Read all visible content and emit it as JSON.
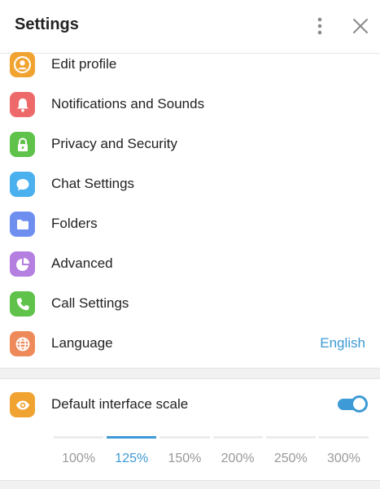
{
  "header": {
    "title": "Settings",
    "more_icon": "more-vertical-icon",
    "close_icon": "close-icon"
  },
  "menu": [
    {
      "label": "Edit profile",
      "icon": "user-icon",
      "color": "#f0a330"
    },
    {
      "label": "Notifications and Sounds",
      "icon": "bell-icon",
      "color": "#ee6a6a"
    },
    {
      "label": "Privacy and Security",
      "icon": "lock-icon",
      "color": "#5fc24a"
    },
    {
      "label": "Chat Settings",
      "icon": "chat-bubble-icon",
      "color": "#4ab0ee"
    },
    {
      "label": "Folders",
      "icon": "folder-icon",
      "color": "#6e8ff0"
    },
    {
      "label": "Advanced",
      "icon": "pie-chart-icon",
      "color": "#b47fe0"
    },
    {
      "label": "Call Settings",
      "icon": "phone-icon",
      "color": "#5fc24a"
    },
    {
      "label": "Language",
      "icon": "globe-icon",
      "color": "#ee8a5a",
      "value": "English"
    }
  ],
  "scale": {
    "label": "Default interface scale",
    "icon": "eye-icon",
    "icon_color": "#f0a330",
    "toggle_on": true,
    "options": [
      "100%",
      "125%",
      "150%",
      "200%",
      "250%",
      "300%"
    ],
    "selected": "125%"
  },
  "colors": {
    "accent": "#3d9ad6",
    "icon_fg": "#ffffff",
    "muted": "#999999"
  }
}
